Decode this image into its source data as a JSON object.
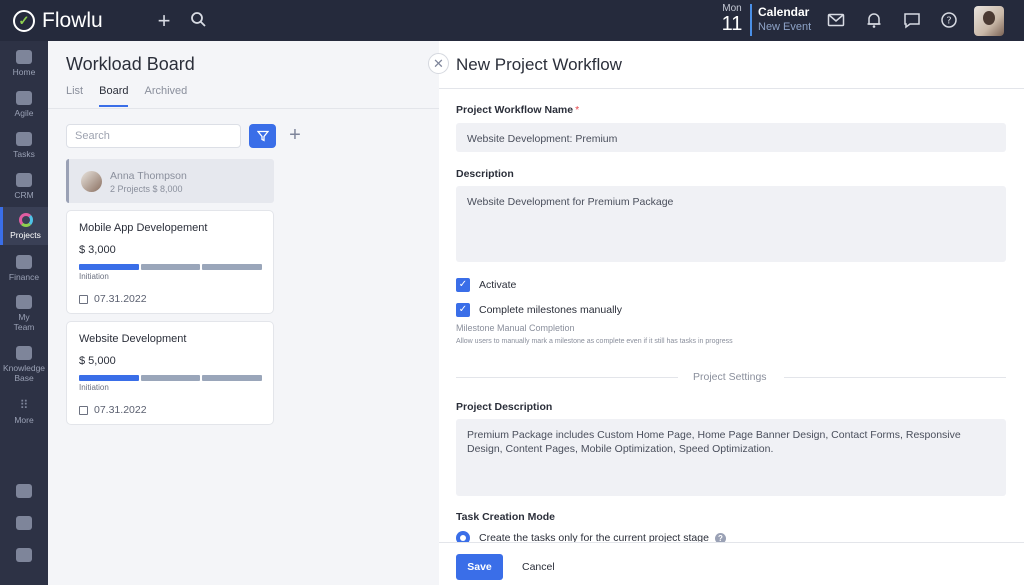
{
  "app": {
    "name": "Flowlu"
  },
  "topbar": {
    "date": {
      "dow": "Mon",
      "day": "11"
    },
    "calendar": {
      "title": "Calendar",
      "subtitle": "New Event"
    }
  },
  "sidebar": {
    "items": [
      {
        "label": "Home",
        "icon": "home-icon"
      },
      {
        "label": "Agile",
        "icon": "agile-icon"
      },
      {
        "label": "Tasks",
        "icon": "tasks-icon"
      },
      {
        "label": "CRM",
        "icon": "crm-icon"
      },
      {
        "label": "Projects",
        "icon": "projects-icon",
        "active": true
      },
      {
        "label": "Finance",
        "icon": "finance-icon"
      },
      {
        "label": "My",
        "label2": "Team",
        "icon": "team-icon"
      },
      {
        "label": "Knowledge",
        "label2": "Base",
        "icon": "knowledge-base-icon"
      },
      {
        "label": "More",
        "icon": "more-icon"
      }
    ]
  },
  "board": {
    "title": "Workload Board",
    "tabs": [
      {
        "label": "List"
      },
      {
        "label": "Board",
        "active": true
      },
      {
        "label": "Archived"
      }
    ],
    "search_placeholder": "Search",
    "person": {
      "name": "Anna Thompson",
      "meta": "2 Projects $ 8,000"
    },
    "projects": [
      {
        "name": "Mobile App Developement",
        "value": "$ 3,000",
        "stage": "Initiation",
        "date": "07.31.2022",
        "progress_segments": 1
      },
      {
        "name": "Website Development",
        "value": "$ 5,000",
        "stage": "Initiation",
        "date": "07.31.2022",
        "progress_segments": 1
      }
    ]
  },
  "dialog": {
    "title": "New Project Workflow",
    "name_label": "Project Workflow Name",
    "name_required_mark": "*",
    "name_value": "Website Development: Premium",
    "description_label": "Description",
    "description_value": "Website Development for Premium Package",
    "activate_label": "Activate",
    "milestones_label": "Complete milestones manually",
    "milestone_help_title": "Milestone Manual Completion",
    "milestone_help_text": "Allow users to manually mark a milestone as complete even if it still has tasks in progress",
    "settings_separator": "Project Settings",
    "project_description_label": "Project Description",
    "project_description_value": "Premium Package includes Custom Home Page, Home Page Banner Design, Contact Forms, Responsive Design, Content Pages, Mobile Optimization, Speed Optimization.",
    "task_mode_label": "Task Creation Mode",
    "task_mode_option": "Create the tasks only for the current project stage",
    "save_label": "Save",
    "cancel_label": "Cancel"
  },
  "colors": {
    "accent": "#3a6ee8",
    "topbar": "#252a3c",
    "sidebar": "#2d3245"
  }
}
